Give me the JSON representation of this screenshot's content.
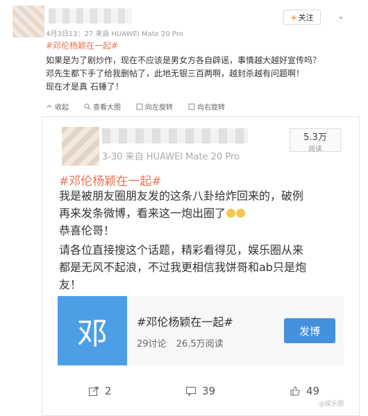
{
  "post": {
    "follow_label": "关注",
    "meta": "4月3日13：27 来自 HUAWEI Mate 20 Pro",
    "hashtag": "#邓伦杨颖在一起#",
    "lines": [
      "如果是为了剧炒作，现在不应该是男女方各自辟谣，事情越大越好宣传吗？",
      "邓先生都下手了给我删帖了，此地无银三百两啊，越封杀越有问题啊！",
      "现在才是真 石锤了！"
    ],
    "toolbar": {
      "collect": "收起",
      "view_large": "查看大图",
      "rotate_left": "向左旋转",
      "rotate_right": "向右旋转"
    }
  },
  "repost": {
    "meta": "3-30  来自 HUAWEI Mate 20 Pro",
    "views_count": "5.3万",
    "views_label": "阅读",
    "hashtag": "#邓伦杨颖在一起#",
    "lines": [
      "我是被朋友圈朋友发的这条八卦给炸回来的，破例",
      "再来发条微博，看来这一炮出圈了",
      "恭喜伦哥！",
      "请各位直接搜这个话题，精彩看得见，娱乐圈从来",
      "都是无风不起浪，不过我更相信我饼哥和ab只是炮",
      "友！"
    ],
    "topic": {
      "icon_char": "邓",
      "title": "#邓伦杨颖在一起#",
      "discussions": "29讨论",
      "reads": "26.5万阅读",
      "button": "发博"
    },
    "toolbar": {
      "share_count": "2",
      "comment_count": "39",
      "like_count": "49"
    },
    "watermark": "@娱乐圈"
  },
  "colors": {
    "accent_orange": "#eb7350",
    "topic_blue": "#4d9fe5",
    "button_blue": "#4490dc"
  }
}
